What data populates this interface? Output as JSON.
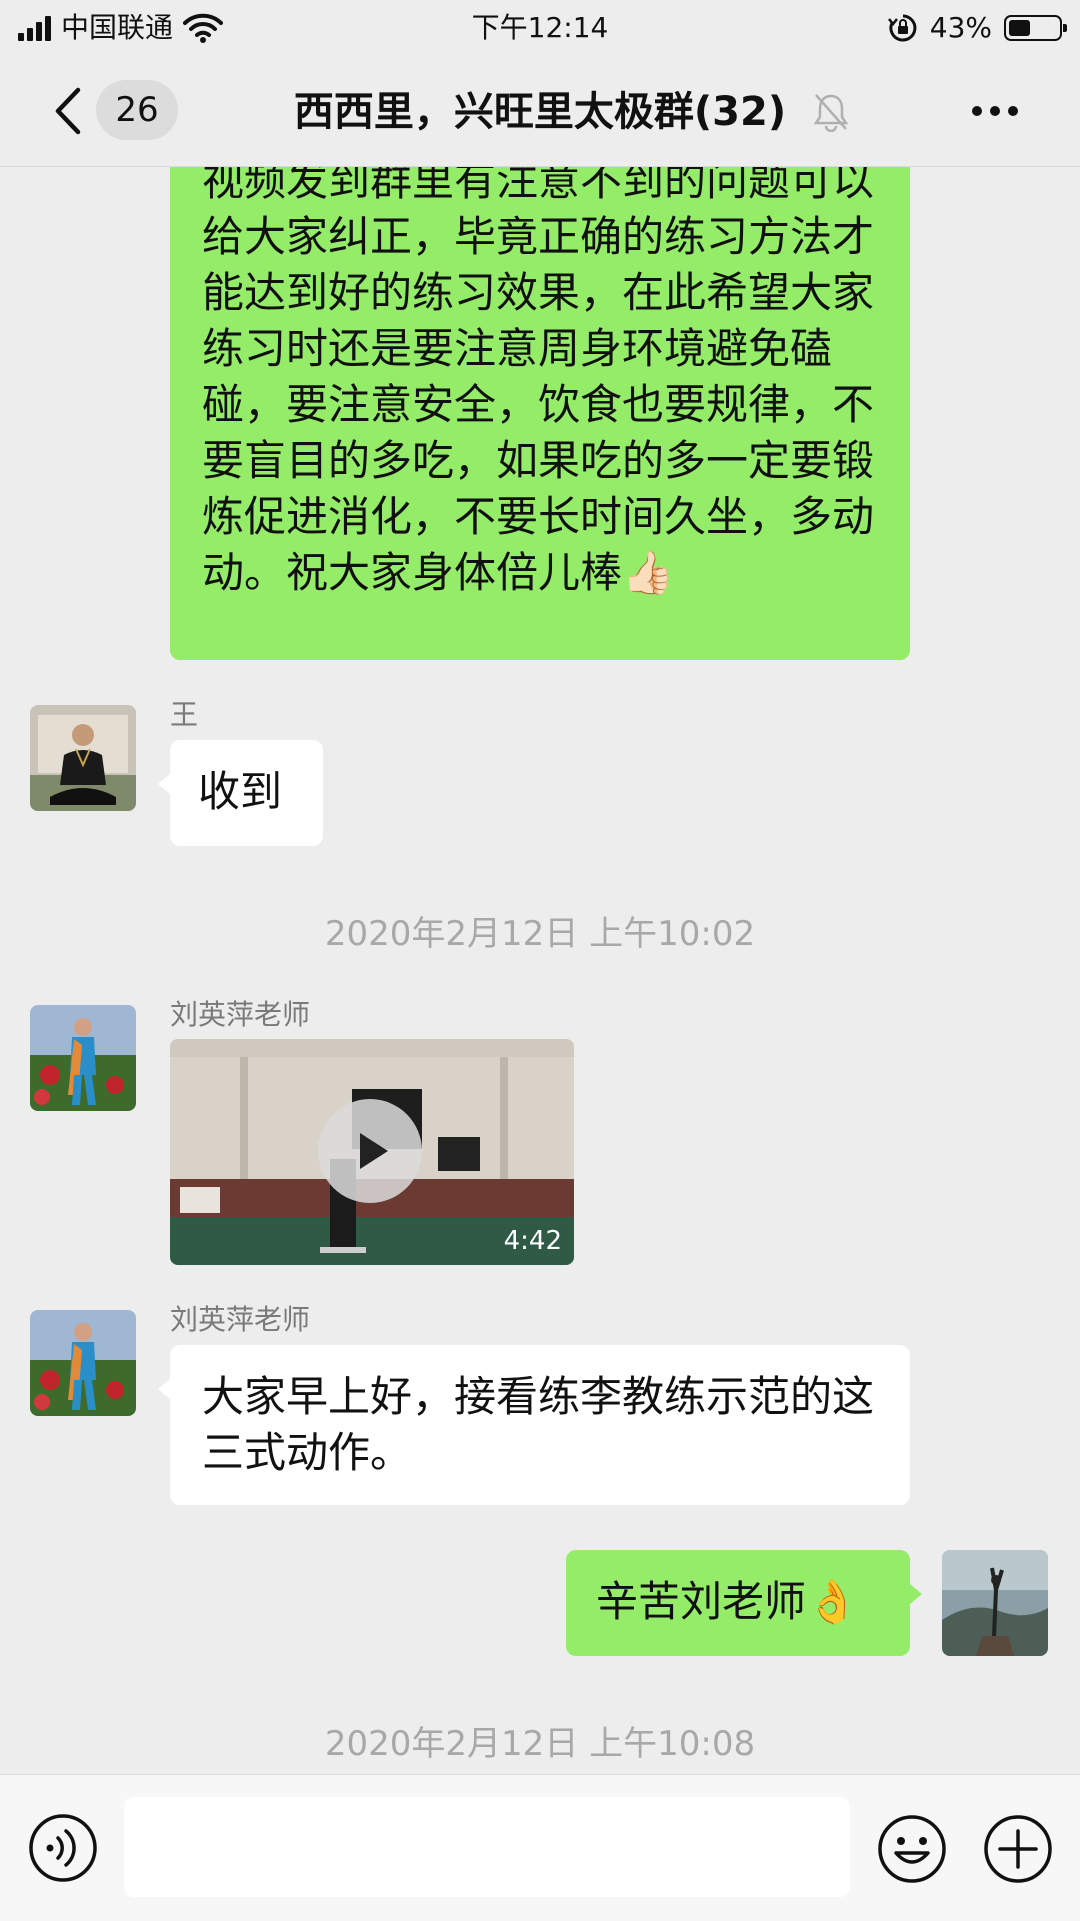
{
  "status_bar": {
    "carrier": "中国联通",
    "time": "下午12:14",
    "battery_percent": "43%",
    "battery_level": 0.43,
    "icons": [
      "signal-icon",
      "wifi-icon",
      "rotation-lock-icon",
      "battery-icon"
    ]
  },
  "nav": {
    "back_icon": "chevron-left-icon",
    "unread_count": "26",
    "title": "西西里，兴旺里太极群(32)",
    "mute_icon": "bell-muted-icon",
    "more_icon": "more-dots-icon"
  },
  "messages": {
    "m1_text": "视频发到群里有注意不到的问题可以给大家纠正，毕竟正确的练习方法才能达到好的练习效果，在此希望大家练习时还是要注意周身环境避免磕碰，要注意安全，饮食也要规律，不要盲目的多吃，如果吃的多一定要锻炼促进消化，不要长时间久坐，多动动。祝大家身体倍儿棒👍🏻",
    "m2_sender": "王",
    "m2_text": "收到",
    "ts1": "2020年2月12日 上午10:02",
    "m3_sender": "刘英萍老师",
    "m3_video_duration": "4:42",
    "m4_sender": "刘英萍老师",
    "m4_text": "大家早上好，接看练李教练示范的这三式动作。",
    "m5_text": "辛苦刘老师👌",
    "ts2": "2020年2月12日 上午10:08"
  },
  "input_bar": {
    "placeholder": "",
    "voice_icon": "voice-icon",
    "emoji_icon": "emoji-icon",
    "plus_icon": "plus-icon"
  },
  "colors": {
    "background": "#ededed",
    "bubble_self": "#95ec69",
    "bubble_other": "#ffffff",
    "timestamp": "#a8a8a8"
  }
}
